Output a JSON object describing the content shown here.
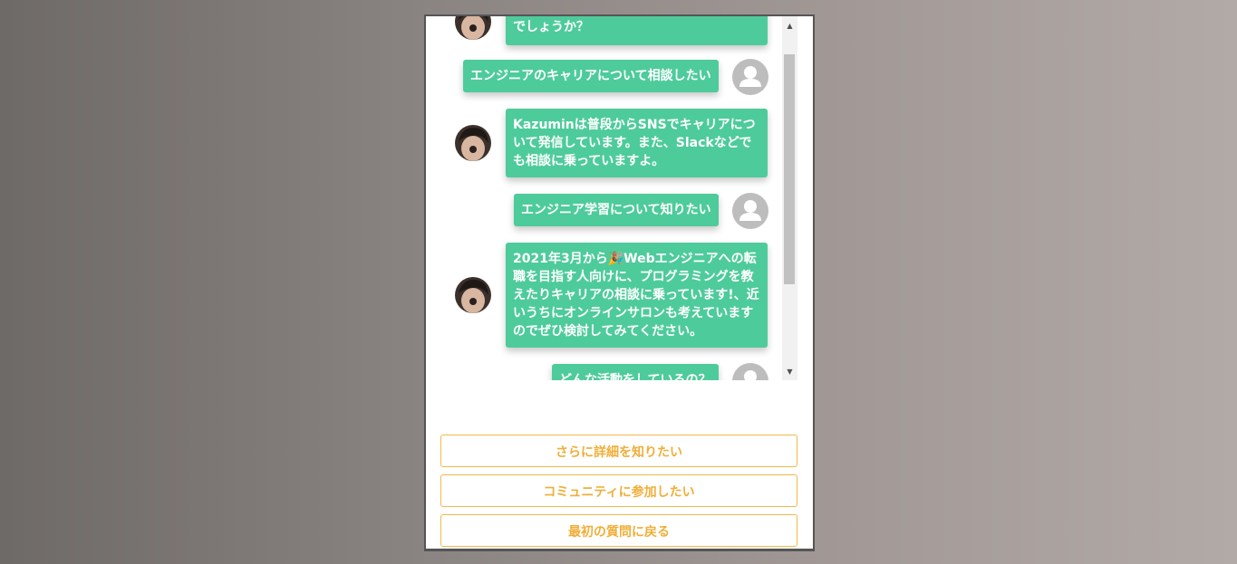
{
  "chat": {
    "messages": [
      {
        "sender": "bot",
        "text": "でしょうか？"
      },
      {
        "sender": "user",
        "text": "エンジニアのキャリアについて相談したい"
      },
      {
        "sender": "bot",
        "text": "Kazuminは普段からSNSでキャリアについて発信しています。また、Slackなどでも相談に乗っていますよ。"
      },
      {
        "sender": "user",
        "text": "エンジニア学習について知りたい"
      },
      {
        "sender": "bot",
        "text": "2021年3月から🎉Webエンジニアへの転職を目指す人向けに、プログラミングを教えたりキャリアの相談に乗っています!、近いうちにオンラインサロンも考えていますのでぜひ検討してみてください。"
      },
      {
        "sender": "user",
        "text": "どんな活動をしているの？"
      }
    ]
  },
  "scrollbar": {
    "up_arrow": "▲",
    "down_arrow": "▼"
  },
  "options": {
    "more_details": "さらに詳細を知りたい",
    "join_community": "コミュニティに参加したい",
    "back_to_first": "最初の質問に戻る"
  },
  "colors": {
    "bot_bubble": "#4ecb9b",
    "option_accent": "#f0ae38"
  }
}
